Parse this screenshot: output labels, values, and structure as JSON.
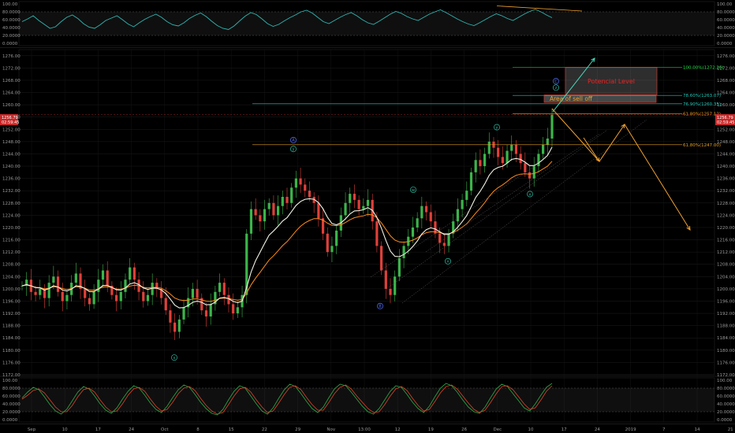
{
  "colors": {
    "background": "#000000",
    "grid": "#1c1c1c",
    "axis_text": "#9a9a9a",
    "bull": "#3bb54a",
    "bear": "#e0403a",
    "ema_fast": "#f3f3e6",
    "ema_slow": "#ff8c1a",
    "rsi_line": "#2fb6b2",
    "stoch_k": "#2ea043",
    "stoch_d": "#e0442a",
    "fib_green": "#22dd44",
    "fib_teal": "#22c8b8",
    "fib_orange": "#e8a020",
    "forecast": "#f0a030",
    "impulse": "#48e0c0",
    "wave_blue": "#5570ff",
    "wave_teal": "#2fb6a0"
  },
  "chart_data": [
    {
      "type": "line",
      "panel": "rsi",
      "ylim": [
        0,
        100
      ],
      "y_ticks": [
        "100.00",
        "80.0000",
        "60.0000",
        "40.0000",
        "20.0000",
        "0.0000"
      ],
      "overbought": 80,
      "oversold": 20,
      "series": [
        {
          "values": [
            55,
            62,
            70,
            58,
            48,
            38,
            42,
            55,
            66,
            72,
            63,
            50,
            41,
            38,
            47,
            58,
            64,
            70,
            60,
            49,
            42,
            52,
            61,
            68,
            74,
            66,
            55,
            47,
            44,
            52,
            63,
            71,
            77,
            68,
            56,
            45,
            38,
            35,
            44,
            57,
            69,
            78,
            73,
            62,
            50,
            43,
            48,
            57,
            65,
            72,
            80,
            84,
            77,
            66,
            55,
            50,
            58,
            66,
            73,
            78,
            70,
            60,
            52,
            48,
            56,
            65,
            74,
            81,
            76,
            68,
            62,
            58,
            66,
            74,
            80,
            85,
            78,
            70,
            62,
            55,
            49,
            45,
            52,
            60,
            68,
            75,
            70,
            63,
            58,
            66,
            74,
            81,
            86,
            80,
            72,
            65
          ]
        }
      ],
      "trendline": "divergence"
    },
    {
      "type": "candlestick",
      "panel": "price",
      "ylim": [
        1172,
        1278
      ],
      "y_ticks": [
        "1276.00",
        "1272.00",
        "1268.00",
        "1264.00",
        "1260.00",
        "1256.00",
        "1252.00",
        "1248.00",
        "1244.00",
        "1240.00",
        "1236.00",
        "1232.00",
        "1228.00",
        "1224.00",
        "1220.00",
        "1216.00",
        "1212.00",
        "1208.00",
        "1204.00",
        "1200.00",
        "1196.00",
        "1192.00",
        "1188.00",
        "1184.00",
        "1180.00",
        "1176.00",
        "1172.00"
      ],
      "x_ticks": [
        "Sep",
        "10",
        "17",
        "24",
        "Oct",
        "8",
        "15",
        "22",
        "29",
        "Nov",
        "13:00",
        "12",
        "19",
        "26",
        "Dec",
        "10",
        "17",
        "24",
        "2019",
        "7",
        "14",
        "21"
      ],
      "last_price_labels": [
        "1256.79",
        "02:59:45"
      ],
      "closes": [
        1201,
        1203,
        1199,
        1198,
        1200,
        1197,
        1202,
        1204,
        1199,
        1196,
        1198,
        1202,
        1205,
        1200,
        1197,
        1195,
        1199,
        1203,
        1206,
        1201,
        1198,
        1196,
        1199,
        1203,
        1207,
        1203,
        1199,
        1196,
        1198,
        1202,
        1200,
        1197,
        1193,
        1189,
        1186,
        1190,
        1194,
        1197,
        1200,
        1197,
        1193,
        1191,
        1195,
        1199,
        1202,
        1198,
        1195,
        1192,
        1194,
        1198,
        1218,
        1226,
        1224,
        1222,
        1226,
        1228,
        1224,
        1227,
        1230,
        1228,
        1233,
        1236,
        1234,
        1232,
        1230,
        1228,
        1223,
        1218,
        1212,
        1214,
        1219,
        1224,
        1228,
        1231,
        1229,
        1226,
        1227,
        1229,
        1222,
        1214,
        1206,
        1200,
        1198,
        1204,
        1210,
        1214,
        1217,
        1220,
        1223,
        1227,
        1225,
        1222,
        1218,
        1215,
        1214,
        1218,
        1222,
        1226,
        1229,
        1232,
        1238,
        1242,
        1240,
        1244,
        1248,
        1246,
        1243,
        1241,
        1245,
        1247,
        1244,
        1241,
        1238,
        1236,
        1240,
        1244,
        1247,
        1249,
        1256.79
      ],
      "series": [
        {
          "name": "EMA fast",
          "values": [
            1201,
            1201.4,
            1201,
            1200.4,
            1200.3,
            1199.6,
            1200.1,
            1201,
            1200.6,
            1199.6,
            1199.3,
            1199.9,
            1201,
            1200.8,
            1200.1,
            1199.1,
            1199.1,
            1199.9,
            1201.1,
            1201.1,
            1200.5,
            1199.7,
            1199.6,
            1200.3,
            1201.6,
            1202,
            1201.4,
            1200.3,
            1199.8,
            1200.2,
            1200.2,
            1199.7,
            1198.5,
            1196.7,
            1194.7,
            1193.8,
            1193.9,
            1194.6,
            1195.6,
            1196,
            1195.6,
            1194.8,
            1194.9,
            1195.7,
            1197,
            1197.2,
            1196.8,
            1195.9,
            1195.5,
            1196,
            1200.4,
            1205.5,
            1209.2,
            1212,
            1214.8,
            1217.5,
            1218.9,
            1220.4,
            1222.1,
            1223.2,
            1225.2,
            1227.2,
            1228.5,
            1229.2,
            1229.4,
            1229.2,
            1228.1,
            1226.1,
            1223.3,
            1221.3,
            1220.9,
            1221.5,
            1222.8,
            1224.4,
            1225.4,
            1225.5,
            1225.8,
            1226.5,
            1225.6,
            1223.3,
            1219.8,
            1215.8,
            1212.3,
            1210.6,
            1210.5,
            1211.2,
            1212.3,
            1213.8,
            1215.6,
            1217.9,
            1219.3,
            1219.9,
            1219.5,
            1218.6,
            1217.7,
            1217.8,
            1218.6,
            1220.1,
            1221.9,
            1223.9,
            1226.8,
            1229.8,
            1231.8,
            1234.2,
            1237,
            1238.8,
            1239.6,
            1240,
            1241,
            1242.2,
            1242.5,
            1242.2,
            1241.3,
            1240.2,
            1240.2,
            1241,
            1242.2,
            1243.5,
            1246.2
          ]
        },
        {
          "name": "EMA slow",
          "values": [
            1201,
            1201.2,
            1200.9,
            1200.5,
            1200.4,
            1200,
            1200.2,
            1200.7,
            1200.6,
            1200.1,
            1199.8,
            1200.1,
            1200.7,
            1200.6,
            1200.2,
            1199.6,
            1199.6,
            1200,
            1200.6,
            1200.7,
            1200.4,
            1199.9,
            1199.9,
            1200.2,
            1200.9,
            1201.2,
            1201,
            1200.5,
            1200.3,
            1200.5,
            1200.5,
            1200.2,
            1199.4,
            1198.3,
            1197,
            1196.4,
            1196.2,
            1196.3,
            1196.7,
            1196.7,
            1196.4,
            1196,
            1195.9,
            1196.3,
            1196.9,
            1197,
            1196.9,
            1196.5,
            1196.3,
            1196.5,
            1198.6,
            1201.3,
            1203.5,
            1205.4,
            1207.4,
            1209.4,
            1210.8,
            1212.4,
            1214.1,
            1215.4,
            1217.1,
            1218.9,
            1220.4,
            1221.5,
            1222.3,
            1222.9,
            1222.9,
            1222.4,
            1221.4,
            1220.7,
            1220.6,
            1220.9,
            1221.6,
            1222.5,
            1223.2,
            1223.5,
            1223.8,
            1224.3,
            1224.1,
            1223.2,
            1221.5,
            1219.4,
            1217.3,
            1215.9,
            1215.3,
            1215.2,
            1215.4,
            1215.9,
            1216.6,
            1217.6,
            1218.3,
            1218.6,
            1218.6,
            1218.3,
            1218,
            1218,
            1218.4,
            1219.1,
            1220.1,
            1221.2,
            1222.9,
            1224.7,
            1226.3,
            1228.1,
            1230.1,
            1231.8,
            1233,
            1233.9,
            1235,
            1236.2,
            1237,
            1237.4,
            1237.5,
            1237.4,
            1237.6,
            1238.2,
            1239.1,
            1240,
            1241.6
          ]
        }
      ],
      "fib_levels": [
        {
          "label": "100.00%(1272.26)",
          "price": 1272.26
        },
        {
          "label": "78.60%(1263.07)",
          "price": 1263.07
        },
        {
          "label": "76.90%(1260.35)",
          "price": 1260.35
        },
        {
          "label": "61.80%(1257.12)",
          "price": 1257.12
        },
        {
          "label": "61.80%(1247.00)",
          "price": 1247.0
        }
      ],
      "wave_labels": [
        {
          "text": "A",
          "price": 1248.5
        },
        {
          "text": "y",
          "price": 1245.6
        },
        {
          "text": "x",
          "price": 1177.6
        },
        {
          "text": "B",
          "price": 1194.4
        },
        {
          "text": "w",
          "price": 1232.3
        },
        {
          "text": "x",
          "price": 1209.0
        },
        {
          "text": "y",
          "price": 1252.7
        },
        {
          "text": "x",
          "price": 1230.9
        },
        {
          "text": "C",
          "price": 1267.7
        },
        {
          "text": "z",
          "price": 1265.6
        }
      ],
      "annotations": {
        "potential_level": "Potencial Level",
        "sell_off": "Area of sell off"
      }
    },
    {
      "type": "line",
      "panel": "stochastic",
      "ylim": [
        0,
        100
      ],
      "y_ticks": [
        "100.00",
        "80.0000",
        "60.0000",
        "40.0000",
        "20.0000",
        "0.0000"
      ],
      "overbought": 80,
      "oversold": 20,
      "series": [
        {
          "values": [
            55,
            70,
            82,
            76,
            58,
            38,
            22,
            14,
            26,
            48,
            70,
            84,
            78,
            60,
            40,
            24,
            16,
            30,
            52,
            72,
            86,
            80,
            62,
            42,
            26,
            18,
            34,
            56,
            76,
            88,
            82,
            64,
            44,
            28,
            16,
            12,
            26,
            50,
            72,
            86,
            80,
            60,
            40,
            22,
            14,
            30,
            54,
            76,
            90,
            84,
            66,
            46,
            28,
            18,
            32,
            56,
            78,
            90,
            86,
            70,
            52,
            34,
            20,
            14,
            28,
            50,
            72,
            86,
            82,
            64,
            44,
            28,
            18,
            34,
            58,
            80,
            92,
            86,
            70,
            50,
            32,
            20,
            16,
            32,
            56,
            78,
            90,
            84,
            66,
            48,
            30,
            22,
            40,
            62,
            82,
            92
          ]
        },
        {
          "values": [
            52,
            62,
            74,
            78,
            68,
            50,
            32,
            20,
            20,
            36,
            58,
            76,
            80,
            70,
            50,
            32,
            20,
            22,
            40,
            62,
            78,
            82,
            72,
            52,
            34,
            22,
            26,
            44,
            66,
            80,
            84,
            74,
            54,
            36,
            22,
            14,
            18,
            38,
            60,
            78,
            82,
            70,
            50,
            32,
            18,
            22,
            42,
            64,
            82,
            86,
            76,
            56,
            38,
            24,
            24,
            44,
            66,
            82,
            88,
            78,
            60,
            44,
            28,
            18,
            20,
            38,
            60,
            78,
            84,
            74,
            54,
            36,
            22,
            26,
            46,
            68,
            84,
            88,
            78,
            60,
            42,
            26,
            18,
            24,
            44,
            66,
            84,
            86,
            76,
            58,
            40,
            26,
            30,
            50,
            72,
            86
          ]
        }
      ]
    }
  ]
}
